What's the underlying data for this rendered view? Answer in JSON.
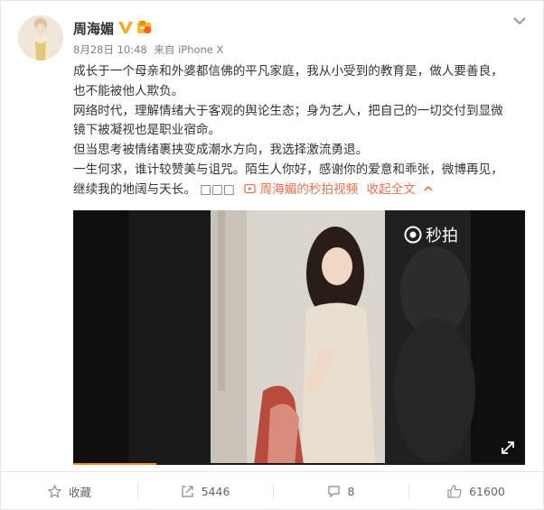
{
  "post": {
    "username": "周海媚",
    "timestamp": "8月28日 10:48",
    "source_prefix": "来自",
    "source": "iPhone X",
    "paragraphs": [
      "成长于一个母亲和外婆都信佛的平凡家庭，我从小受到的教育是，做人要善良，",
      "也不能被他人欺负。",
      "网络时代，理解情绪大于客观的舆论生态；身为艺人，把自己的一切交付到显微",
      "镜下被凝视也是职业宿命。",
      "但当思考被情绪裹挟变成潮水方向，我选择激流勇退。",
      "一生何求，谁计较赞美与诅咒。陌生人你好，感谢你的爱意和乖张，微博再见，",
      "继续我的地阔与天长。"
    ],
    "inline_boxes": "□□□",
    "video_link": "周海媚的秒拍视频",
    "collapse_label": "收起全文"
  },
  "video": {
    "watermark": "秒拍"
  },
  "actions": {
    "favorite": "收藏",
    "repost": "5446",
    "comment": "8",
    "like": "61600"
  },
  "colors": {
    "link": "#eb7350",
    "vip_gold": "#f5a623",
    "progress": "#f28c28"
  },
  "icons": [
    "avatar",
    "verified-v-icon",
    "member-badge-icon",
    "chevron-down-icon",
    "video-link-icon",
    "chevron-up-icon",
    "miaopai-logo-icon",
    "fullscreen-icon",
    "star-icon",
    "repost-icon",
    "comment-icon",
    "thumbs-up-icon"
  ]
}
